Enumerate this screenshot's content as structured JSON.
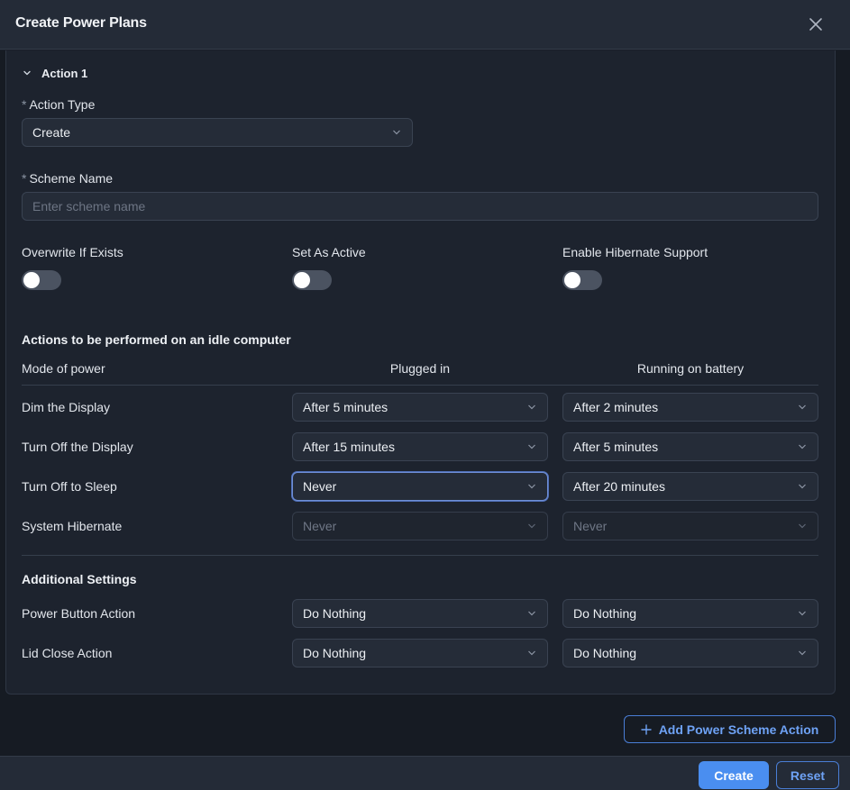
{
  "header": {
    "title": "Create Power Plans"
  },
  "action": {
    "label": "Action 1"
  },
  "form": {
    "action_type_label": "Action Type",
    "action_type_value": "Create",
    "scheme_name_label": "Scheme Name",
    "scheme_name_placeholder": "Enter scheme name",
    "required_mark": "*",
    "toggles": [
      {
        "label": "Overwrite If Exists",
        "on": false
      },
      {
        "label": "Set As Active",
        "on": false
      },
      {
        "label": "Enable Hibernate Support",
        "on": false
      }
    ]
  },
  "idle": {
    "title": "Actions to be performed on an idle computer",
    "col_mode": "Mode of power",
    "col_plugged": "Plugged in",
    "col_battery": "Running on battery",
    "rows": [
      {
        "label": "Dim the Display",
        "plugged": "After 5 minutes",
        "battery": "After 2 minutes"
      },
      {
        "label": "Turn Off the Display",
        "plugged": "After 15 minutes",
        "battery": "After 5 minutes"
      },
      {
        "label": "Turn Off to Sleep",
        "plugged": "Never",
        "battery": "After 20 minutes"
      },
      {
        "label": "System Hibernate",
        "plugged": "Never",
        "battery": "Never"
      }
    ]
  },
  "additional": {
    "title": "Additional Settings",
    "rows": [
      {
        "label": "Power Button Action",
        "plugged": "Do Nothing",
        "battery": "Do Nothing"
      },
      {
        "label": "Lid Close Action",
        "plugged": "Do Nothing",
        "battery": "Do Nothing"
      }
    ]
  },
  "add_action_label": "Add Power Scheme Action",
  "footer": {
    "create_label": "Create",
    "reset_label": "Reset"
  },
  "colors": {
    "accent": "#4a8ef0",
    "background": "#1a1f29"
  }
}
